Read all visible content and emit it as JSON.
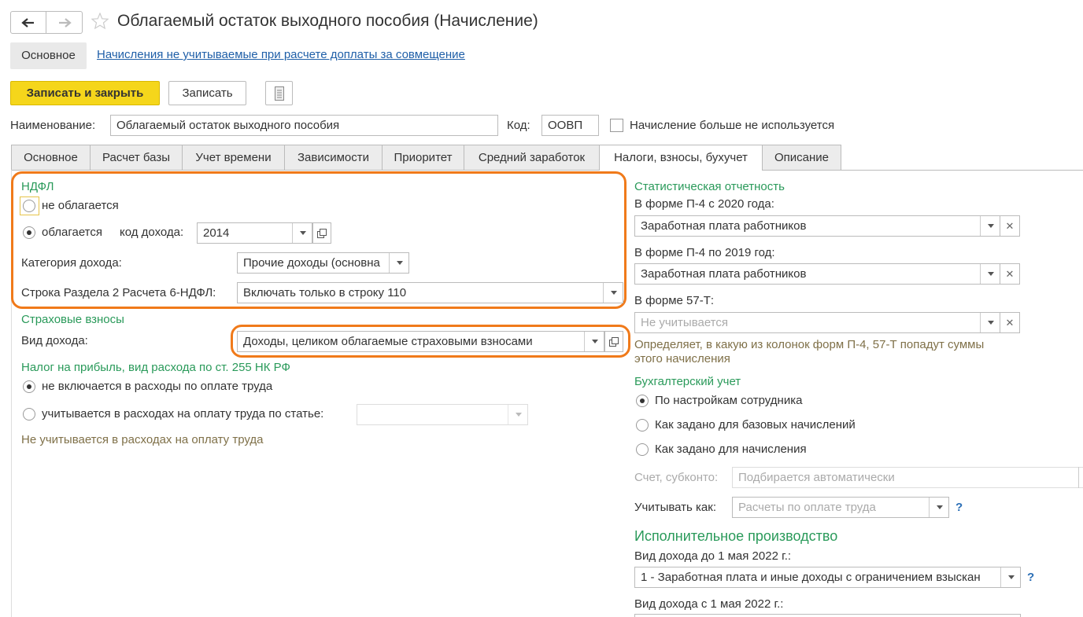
{
  "window": {
    "title": "Облагаемый остаток выходного пособия (Начисление)"
  },
  "top_nav": {
    "main_link": "Основное",
    "second_link": "Начисления не учитываемые при расчете доплаты за совмещение"
  },
  "toolbar": {
    "save_close": "Записать и закрыть",
    "save": "Записать"
  },
  "header": {
    "name_label": "Наименование:",
    "name_value": "Облагаемый остаток выходного пособия",
    "code_label": "Код:",
    "code_value": "ООВП",
    "unused_label": "Начисление больше не используется"
  },
  "tabs": [
    "Основное",
    "Расчет базы",
    "Учет времени",
    "Зависимости",
    "Приоритет",
    "Средний заработок",
    "Налоги, взносы, бухучет",
    "Описание"
  ],
  "ndfl": {
    "title": "НДФЛ",
    "not_taxed": "не облагается",
    "taxed": "облагается",
    "income_code_label": "код дохода:",
    "income_code_value": "2014",
    "category_label": "Категория дохода:",
    "category_value": "Прочие доходы (основна",
    "row_label": "Строка Раздела 2 Расчета 6-НДФЛ:",
    "row_value": "Включать только в строку 110"
  },
  "insurance": {
    "title": "Страховые взносы",
    "income_type_label": "Вид дохода:",
    "income_type_value": "Доходы, целиком облагаемые страховыми взносами"
  },
  "profit_tax": {
    "title": "Налог на прибыль, вид расхода по ст. 255 НК РФ",
    "opt1": "не включается в расходы по оплате труда",
    "opt2": "учитывается в расходах на оплату труда по статье:",
    "note": "Не учитывается в расходах на оплату труда"
  },
  "stats": {
    "title": "Статистическая отчетность",
    "p4_2020_label": "В форме П-4 с 2020 года:",
    "p4_2020_value": "Заработная плата работников",
    "p4_2019_label": "В форме П-4 по 2019 год:",
    "p4_2019_value": "Заработная плата работников",
    "f57_label": "В форме 57-Т:",
    "f57_value": "Не учитывается",
    "note_line1": "Определяет, в какую из колонок форм П-4, 57-Т попадут суммы",
    "note_line2": "этого начисления"
  },
  "accounting": {
    "title": "Бухгалтерский учет",
    "opt1": "По настройкам сотрудника",
    "opt2": "Как задано для базовых начислений",
    "opt3": "Как задано для начисления",
    "account_label": "Счет, субконто:",
    "account_value": "Подбирается автоматически",
    "account_as_label": "Учитывать как:",
    "account_as_value": "Расчеты по оплате труда",
    "help": "?"
  },
  "enforcement": {
    "title": "Исполнительное производство",
    "before_label": "Вид дохода до 1 мая 2022 г.:",
    "before_value": "1 - Заработная плата и иные доходы с ограничением взыскан",
    "after_label": "Вид дохода с 1 мая 2022 г.:",
    "help": "?"
  },
  "colors": {
    "accent_green": "#2a9a5a",
    "highlight": "#f07a1a",
    "primary_button": "#f5d61b",
    "link": "#1f5fa8"
  }
}
